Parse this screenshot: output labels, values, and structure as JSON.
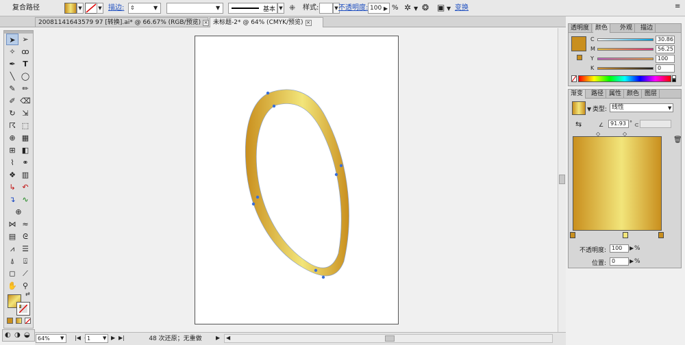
{
  "control": {
    "object_label": "复合路径",
    "stroke_label": "描边:",
    "brush_label": "基本",
    "style_label": "样式:",
    "opacity_label": "不透明度:",
    "opacity_value": "100",
    "opacity_unit": "%",
    "transform_label": "变换"
  },
  "tabs": [
    {
      "label": "20081141643579 97 [转换].ai* @ 66.67% (RGB/预览)",
      "close": "×"
    },
    {
      "label": "未标题-2* @ 64% (CMYK/预览)",
      "close": "×"
    }
  ],
  "status": {
    "zoom": "64%",
    "page": "1",
    "undo_text": "48 次还原；无重做"
  },
  "color_panel": {
    "tabs": [
      "透明度",
      "颜色",
      "外观",
      "描边"
    ],
    "channels": [
      {
        "label": "C",
        "value": "30.86"
      },
      {
        "label": "M",
        "value": "56.25"
      },
      {
        "label": "Y",
        "value": "100"
      },
      {
        "label": "K",
        "value": "0"
      }
    ]
  },
  "gradient_panel": {
    "tabs": [
      "渐变",
      "路径",
      "属性",
      "颜色",
      "图层"
    ],
    "type_label": "类型:",
    "type_value": "线性",
    "angle_value": "91.93",
    "opacity_label": "不透明度:",
    "opacity_value": "100",
    "position_label": "位置:",
    "position_value": "0",
    "unit": "%"
  },
  "colors": {
    "gold_dark": "#c98f1e",
    "gold_light": "#f2e57a",
    "anchor": "#3a6fd8"
  }
}
